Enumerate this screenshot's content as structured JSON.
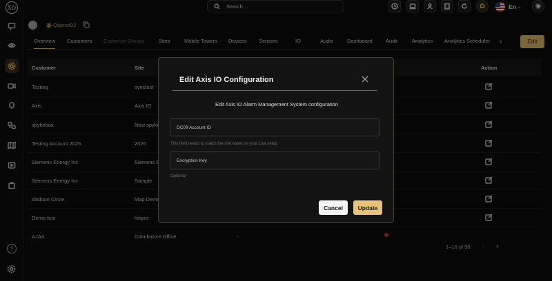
{
  "app": {
    "logo_text": "XO"
  },
  "search": {
    "placeholder": "Search ..."
  },
  "lang": {
    "code": "En"
  },
  "account": {
    "name": "Qaprod02"
  },
  "tabs": [
    {
      "label": "Overview"
    },
    {
      "label": "Customers"
    },
    {
      "label": "Customer Groups"
    },
    {
      "label": "Sites"
    },
    {
      "label": "Mobile Towers"
    },
    {
      "label": "Devices"
    },
    {
      "label": "Sensors"
    },
    {
      "label": "IO"
    },
    {
      "label": "Audio"
    },
    {
      "label": "Dashboard"
    },
    {
      "label": "Audit"
    },
    {
      "label": "Analytics"
    },
    {
      "label": "Analytics Scheduler"
    }
  ],
  "toolbar": {
    "edit_label": "Edit"
  },
  "table": {
    "headers": {
      "customer": "Customer",
      "site": "Site",
      "action": "Action"
    },
    "rows": [
      {
        "customer": "Testing",
        "site": "synctest"
      },
      {
        "customer": "Axis",
        "site": "Axis IO"
      },
      {
        "customer": "spykebox",
        "site": "New spyke"
      },
      {
        "customer": "Testing Account 2026",
        "site": "2026"
      },
      {
        "customer": "Siemens Energy Inc",
        "site": "Siemens E"
      },
      {
        "customer": "Siemens Energy Inc",
        "site": "Sample"
      },
      {
        "customer": "Abdoun Circle",
        "site": "Map Demo"
      },
      {
        "customer": "Demo test",
        "site": "hikpro"
      },
      {
        "customer": "AJAX",
        "site": "Coimbatore Office",
        "extra": "-"
      }
    ],
    "pagination": "1–10 of 58"
  },
  "modal": {
    "title": "Edit Axis IO Configuration",
    "subtitle": "Edit Axis IO Alarm Management System configuration",
    "account_id_placeholder": "DC09 Account ID",
    "account_id_hint": "This field needs to match the site name on your Lisa setup",
    "encryption_placeholder": "Encryption Key",
    "encryption_hint": "Optional",
    "cancel_label": "Cancel",
    "update_label": "Update"
  },
  "colors": {
    "accent": "#e0b86a",
    "alert": "#c0392b"
  }
}
